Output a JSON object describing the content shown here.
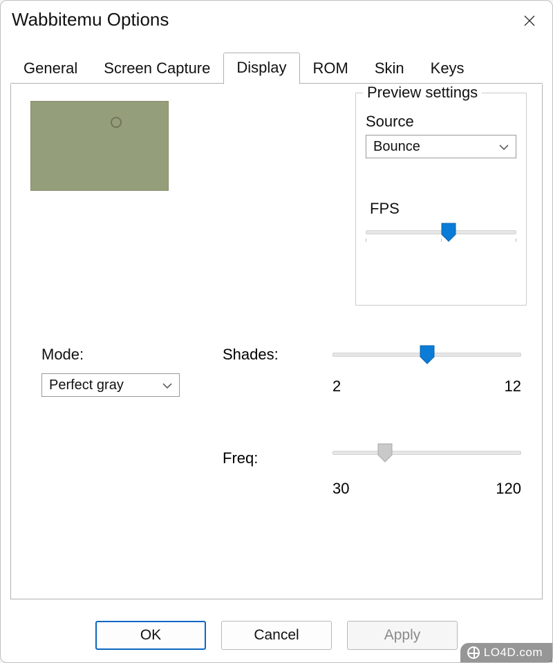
{
  "window": {
    "title": "Wabbitemu Options"
  },
  "tabs": [
    "General",
    "Screen Capture",
    "Display",
    "ROM",
    "Skin",
    "Keys"
  ],
  "active_tab": "Display",
  "preview": {
    "legend": "Preview settings",
    "source_label": "Source",
    "source_value": "Bounce",
    "fps_label": "FPS"
  },
  "mode": {
    "label": "Mode:",
    "value": "Perfect gray"
  },
  "shades": {
    "label": "Shades:",
    "min": "2",
    "max": "12"
  },
  "freq": {
    "label": "Freq:",
    "min": "30",
    "max": "120"
  },
  "buttons": {
    "ok": "OK",
    "cancel": "Cancel",
    "apply": "Apply"
  },
  "watermark": "LO4D.com"
}
